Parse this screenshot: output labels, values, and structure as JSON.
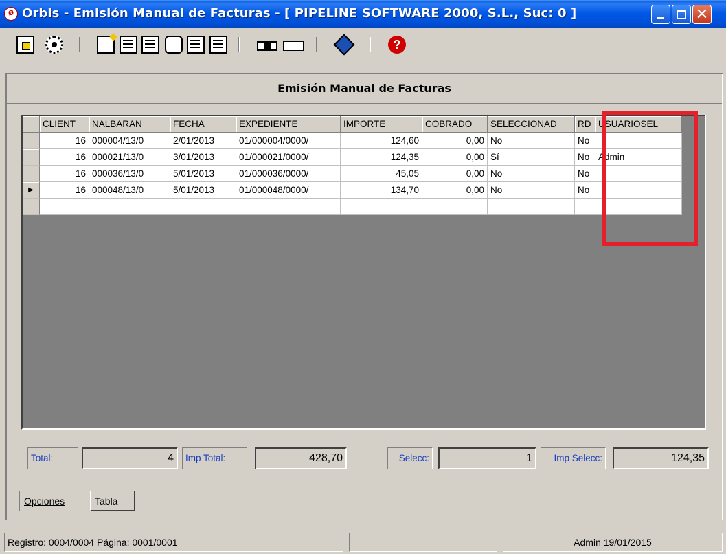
{
  "window": {
    "title": "Orbis - Emisión Manual de Facturas - [ PIPELINE SOFTWARE 2000, S.L.,  Suc: 0 ]",
    "app_icon_text": "Ø",
    "close_glyph": "✕"
  },
  "toolbar": {
    "icons": [
      "exit-icon",
      "config-icon",
      "new-icon",
      "document-icon",
      "list-icon",
      "signature-icon",
      "report-icon",
      "print-icon",
      "mail-selected-icon",
      "mail-icon",
      "book-icon",
      "help-icon"
    ],
    "help_glyph": "?"
  },
  "form": {
    "heading": "Emisión Manual de Facturas"
  },
  "grid": {
    "columns": [
      "CLIENT",
      "NALBARAN",
      "FECHA",
      "EXPEDIENTE",
      "IMPORTE",
      "COBRADO",
      "SELECCIONAD",
      "RD",
      "USUARIOSEL"
    ],
    "rows": [
      {
        "indicator": "",
        "cliente": "16",
        "nalbaran": "000004/13/0",
        "fecha": "2/01/2013",
        "expediente": "01/000004/0000/",
        "importe": "124,60",
        "cobrado": "0,00",
        "seleccionado": "No",
        "rd": "No",
        "usuariosel": ""
      },
      {
        "indicator": "",
        "cliente": "16",
        "nalbaran": "000021/13/0",
        "fecha": "3/01/2013",
        "expediente": "01/000021/0000/",
        "importe": "124,35",
        "cobrado": "0,00",
        "seleccionado": "Sí",
        "rd": "No",
        "usuariosel": "Admin"
      },
      {
        "indicator": "",
        "cliente": "16",
        "nalbaran": "000036/13/0",
        "fecha": "5/01/2013",
        "expediente": "01/000036/0000/",
        "importe": "45,05",
        "cobrado": "0,00",
        "seleccionado": "No",
        "rd": "No",
        "usuariosel": ""
      },
      {
        "indicator": "▶",
        "cliente": "16",
        "nalbaran": "000048/13/0",
        "fecha": "5/01/2013",
        "expediente": "01/000048/0000/",
        "importe": "134,70",
        "cobrado": "0,00",
        "seleccionado": "No",
        "rd": "No",
        "usuariosel": ""
      }
    ]
  },
  "totals": {
    "total_label": "Total:",
    "total_value": "4",
    "imp_total_label": "Imp Total:",
    "imp_total_value": "428,70",
    "selecc_label": "Selecc:",
    "selecc_value": "1",
    "imp_selecc_label": "Imp Selecc:",
    "imp_selecc_value": "124,35"
  },
  "tabs": [
    {
      "label": "Opciones",
      "active": false
    },
    {
      "label": "Tabla",
      "active": true
    }
  ],
  "status": {
    "registro": "Registro: 0004/0004  Página: 0001/0001",
    "middle": "",
    "user_date": "Admin 19/01/2015"
  },
  "colors": {
    "titlebar": "#0058e6",
    "highlight_box": "#e4212b",
    "label_text": "#1a3fbf",
    "grid_empty": "#808080"
  }
}
